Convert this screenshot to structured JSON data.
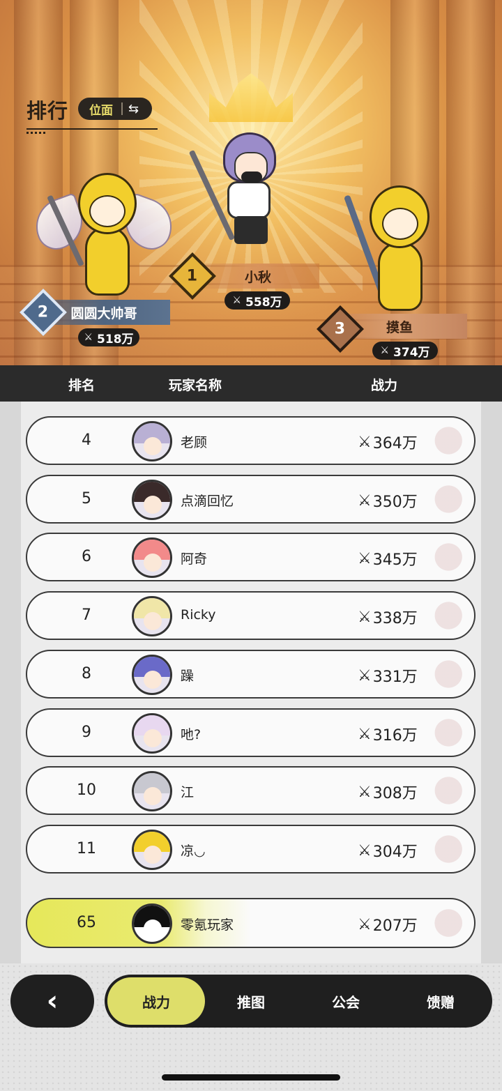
{
  "header": {
    "title": "排行",
    "plane_label": "位面",
    "swap_icon": "⇆"
  },
  "podium": [
    {
      "place": "1",
      "name": "小秋",
      "power": "558万"
    },
    {
      "place": "2",
      "name": "圆圆大帅哥",
      "power": "518万"
    },
    {
      "place": "3",
      "name": "摸鱼",
      "power": "374万"
    }
  ],
  "columns": {
    "rank": "排名",
    "name": "玩家名称",
    "power": "战力"
  },
  "rows": [
    {
      "rank": "4",
      "name": "老顾",
      "power": "364万",
      "hair": "#b9b0d4"
    },
    {
      "rank": "5",
      "name": "点滴回忆",
      "power": "350万",
      "hair": "#3a2a2a"
    },
    {
      "rank": "6",
      "name": "阿奇",
      "power": "345万",
      "hair": "#f28a8a"
    },
    {
      "rank": "7",
      "name": "Ricky",
      "power": "338万",
      "hair": "#f0e6a8"
    },
    {
      "rank": "8",
      "name": "躁",
      "power": "331万",
      "hair": "#6a6ac8"
    },
    {
      "rank": "9",
      "name": "吔?",
      "power": "316万",
      "hair": "#e8d8f0"
    },
    {
      "rank": "10",
      "name": "江",
      "power": "308万",
      "hair": "#c8c8d0"
    },
    {
      "rank": "11",
      "name": "凉◡",
      "power": "304万",
      "hair": "#f2cf2c"
    }
  ],
  "self": {
    "rank": "65",
    "name": "零氪玩家",
    "power": "207万"
  },
  "nav": {
    "back_icon": "‹",
    "tabs": [
      "战力",
      "推图",
      "公会",
      "馈赠"
    ]
  },
  "icons": {
    "power_icon": "⚔"
  },
  "colors": {
    "accent": "#dede6a",
    "dark": "#1f1f1f"
  }
}
